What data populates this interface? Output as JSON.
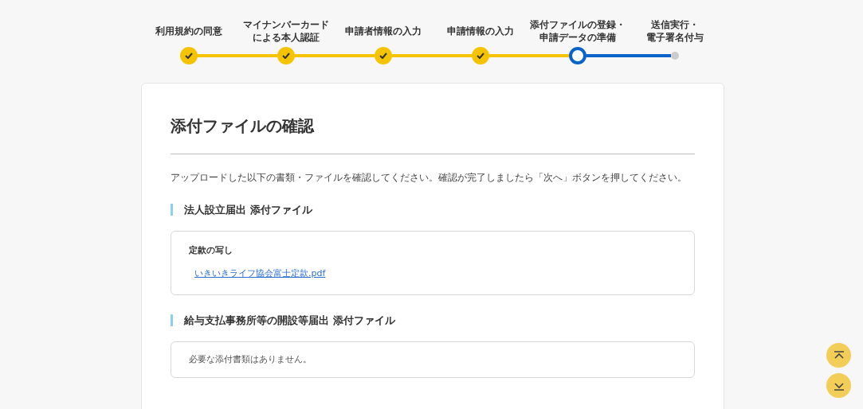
{
  "steps": [
    {
      "lines": [
        "利用規約の同意"
      ],
      "completed": true,
      "current": false
    },
    {
      "lines": [
        "マイナンバーカード",
        "による本人認証"
      ],
      "completed": true,
      "current": false
    },
    {
      "lines": [
        "申請者情報の入力"
      ],
      "completed": true,
      "current": false
    },
    {
      "lines": [
        "申請情報の入力"
      ],
      "completed": true,
      "current": false
    },
    {
      "lines": [
        "添付ファイルの登録・",
        "申請データの準備"
      ],
      "completed": false,
      "current": true
    },
    {
      "lines": [
        "送信実行・",
        "電子署名付与"
      ],
      "completed": false,
      "current": false
    }
  ],
  "title": "添付ファイルの確認",
  "description": "アップロードした以下の書類・ファイルを確認してください。確認が完了しましたら「次へ」ボタンを押してください。",
  "sections": [
    {
      "heading": "法人設立届出 添付ファイル",
      "kind": "files",
      "documents": [
        {
          "name": "定款の写し",
          "files": [
            "いきいきライフ協会富士定款.pdf"
          ]
        }
      ]
    },
    {
      "heading": "給与支払事務所等の開設等届出 添付ファイル",
      "kind": "note",
      "note": "必要な添付書類はありません。"
    }
  ]
}
